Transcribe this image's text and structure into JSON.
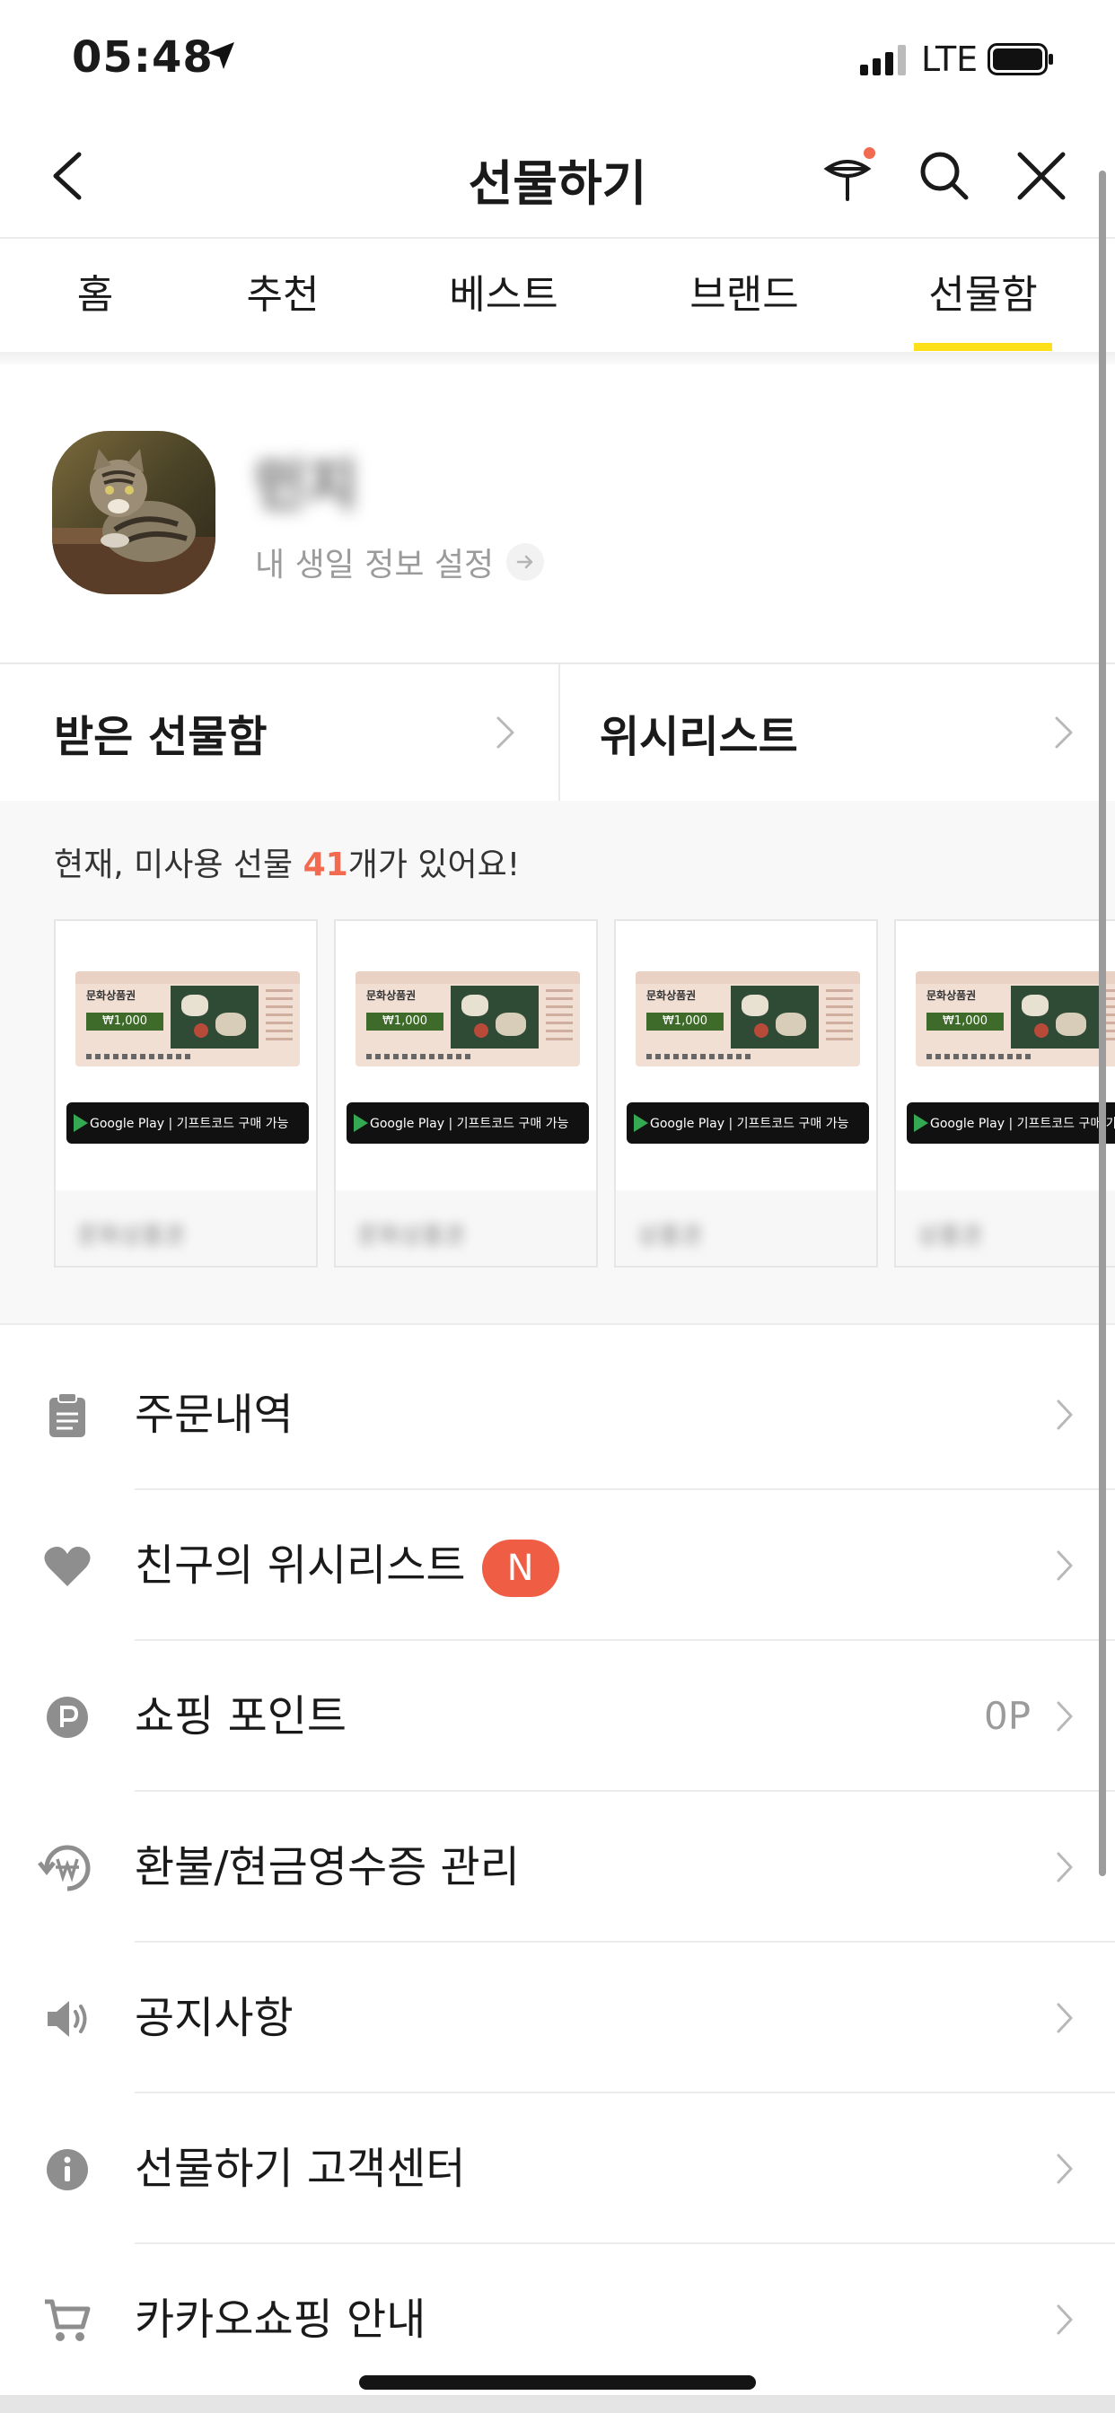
{
  "status_bar": {
    "time": "05:48",
    "network": "LTE"
  },
  "header": {
    "title": "선물하기"
  },
  "tabs": [
    {
      "label": "홈"
    },
    {
      "label": "추천"
    },
    {
      "label": "베스트"
    },
    {
      "label": "브랜드"
    },
    {
      "label": "선물함",
      "active": true
    }
  ],
  "profile": {
    "name": "민지",
    "birthday_link": "내 생일 정보 설정"
  },
  "boxes": {
    "received": "받은 선물함",
    "wishlist": "위시리스트"
  },
  "unused": {
    "prefix": "현재, 미사용 선물 ",
    "count": "41",
    "suffix": "개가 있어요!"
  },
  "gift_cards": [
    {
      "title": "문화상품권",
      "amount": "₩1,000",
      "store_bar": "Google Play | 기프트코드 구매 가능",
      "name": "문화상품권"
    },
    {
      "title": "문화상품권",
      "amount": "₩1,000",
      "store_bar": "Google Play | 기프트코드 구매 가능",
      "name": "문화상품권"
    },
    {
      "title": "문화상품권",
      "amount": "₩1,000",
      "store_bar": "Google Play | 기프트코드 구매 가능",
      "name": "상품권"
    },
    {
      "title": "문화상품권",
      "amount": "₩1,000",
      "store_bar": "Google Play | 기프트코드 구매 가능",
      "name": "상품권"
    }
  ],
  "menu": [
    {
      "label": "주문내역",
      "icon": "clipboard-icon"
    },
    {
      "label": "친구의 위시리스트",
      "icon": "heart-icon",
      "badge": "N"
    },
    {
      "label": "쇼핑 포인트",
      "icon": "point-icon",
      "value": "0P"
    },
    {
      "label": "환불/현금영수증 관리",
      "icon": "refund-icon"
    },
    {
      "label": "공지사항",
      "icon": "speaker-icon"
    },
    {
      "label": "선물하기 고객센터",
      "icon": "info-icon"
    },
    {
      "label": "카카오쇼핑 안내",
      "icon": "cart-icon"
    }
  ],
  "colors": {
    "accent_yellow": "#FDE01A",
    "badge_red": "#F05D45",
    "count_red": "#F26A4F"
  }
}
